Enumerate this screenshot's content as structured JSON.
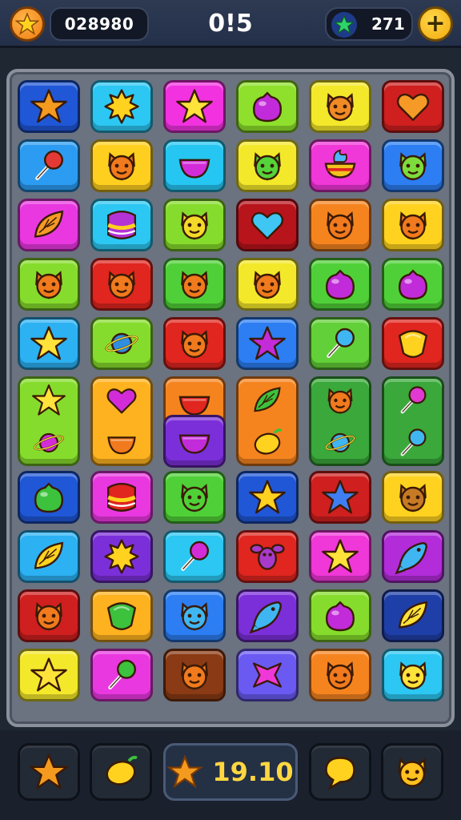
{
  "hud": {
    "coin_icon": "star-icon",
    "score": "028980",
    "timer": "0!5",
    "gems": "271",
    "gem_icon": "star-icon",
    "add_label": "+"
  },
  "board": {
    "tiles": [
      {
        "c": 0,
        "r": 0,
        "bg": "#1f57d6",
        "icon": "star",
        "fg": "#f39a1f"
      },
      {
        "c": 1,
        "r": 0,
        "bg": "#2cc7f2",
        "icon": "sun",
        "fg": "#ffd21f"
      },
      {
        "c": 2,
        "r": 0,
        "bg": "#f232e0",
        "icon": "star",
        "fg": "#ffe23a"
      },
      {
        "c": 3,
        "r": 0,
        "bg": "#8ee02c",
        "icon": "blob",
        "fg": "#c22bd9"
      },
      {
        "c": 4,
        "r": 0,
        "bg": "#f4e82a",
        "icon": "face",
        "fg": "#f08a25"
      },
      {
        "c": 5,
        "r": 0,
        "bg": "#cf1f1f",
        "icon": "heart",
        "fg": "#f59a26"
      },
      {
        "c": 0,
        "r": 1,
        "bg": "#2c9cf2",
        "icon": "pin",
        "fg": "#e53935"
      },
      {
        "c": 1,
        "r": 1,
        "bg": "#ffcf1f",
        "icon": "face",
        "fg": "#f07a1d"
      },
      {
        "c": 2,
        "r": 1,
        "bg": "#26c6f2",
        "icon": "bowl",
        "fg": "#d22cd9"
      },
      {
        "c": 3,
        "r": 1,
        "bg": "#f4e82a",
        "icon": "face",
        "fg": "#54d43a"
      },
      {
        "c": 4,
        "r": 1,
        "bg": "#f037d8",
        "icon": "cup",
        "fg": "#4db6ff"
      },
      {
        "c": 5,
        "r": 1,
        "bg": "#2c7ef2",
        "icon": "face",
        "fg": "#7ddc3c"
      },
      {
        "c": 0,
        "r": 2,
        "bg": "#e938e0",
        "icon": "leaf",
        "fg": "#f59a26"
      },
      {
        "c": 1,
        "r": 2,
        "bg": "#2cc7f2",
        "icon": "stack",
        "fg": "#b433d6"
      },
      {
        "c": 2,
        "r": 2,
        "bg": "#86dc2c",
        "icon": "face",
        "fg": "#f4d92a"
      },
      {
        "c": 3,
        "r": 2,
        "bg": "#b8141c",
        "icon": "heart",
        "fg": "#3fc6f2"
      },
      {
        "c": 4,
        "r": 2,
        "bg": "#f5841f",
        "icon": "face",
        "fg": "#f07a1d"
      },
      {
        "c": 5,
        "r": 2,
        "bg": "#ffd21f",
        "icon": "face",
        "fg": "#f07a1d"
      },
      {
        "c": 0,
        "r": 3,
        "bg": "#86dc2c",
        "icon": "face",
        "fg": "#f07a1d"
      },
      {
        "c": 1,
        "r": 3,
        "bg": "#e0261f",
        "icon": "face",
        "fg": "#f07a1d"
      },
      {
        "c": 2,
        "r": 3,
        "bg": "#50d038",
        "icon": "face",
        "fg": "#f07a1d"
      },
      {
        "c": 3,
        "r": 3,
        "bg": "#f4e82a",
        "icon": "face",
        "fg": "#f07a1d"
      },
      {
        "c": 4,
        "r": 3,
        "bg": "#50d038",
        "icon": "blob",
        "fg": "#c22bd9"
      },
      {
        "c": 5,
        "r": 3,
        "bg": "#50d038",
        "icon": "blob",
        "fg": "#c22bd9"
      },
      {
        "c": 0,
        "r": 4,
        "bg": "#2cb1f2",
        "icon": "star",
        "fg": "#ffe23a"
      },
      {
        "c": 1,
        "r": 4,
        "bg": "#86dc2c",
        "icon": "planet",
        "fg": "#2f8ee0"
      },
      {
        "c": 2,
        "r": 4,
        "bg": "#e0261f",
        "icon": "face",
        "fg": "#f07a1d"
      },
      {
        "c": 3,
        "r": 4,
        "bg": "#2c7ef2",
        "icon": "star",
        "fg": "#c42bd9"
      },
      {
        "c": 4,
        "r": 4,
        "bg": "#62d038",
        "icon": "pin",
        "fg": "#3fb6f2"
      },
      {
        "c": 5,
        "r": 4,
        "bg": "#e0261f",
        "icon": "shield",
        "fg": "#ffd21f"
      },
      {
        "c": 0,
        "r": 5,
        "bg": "#86dc2c",
        "icon": "star",
        "fg": "#ffe23a",
        "tall": true,
        "icon2": "planet",
        "fg2": "#d22cd9"
      },
      {
        "c": 1,
        "r": 5,
        "bg": "#ffb21f",
        "icon": "heart",
        "fg": "#d22cd9",
        "tall": true,
        "icon2": "bowl",
        "fg2": "#f07a1d"
      },
      {
        "c": 2,
        "r": 5,
        "bg": "#f5841f",
        "icon": "bowl",
        "fg": "#e0261f"
      },
      {
        "c": 3,
        "r": 5,
        "bg": "#f5841f",
        "icon": "leaf",
        "fg": "#3cc23c",
        "tall": true,
        "icon2": "lemon",
        "fg2": "#ffd21f"
      },
      {
        "c": 4,
        "r": 5,
        "bg": "#3aa83a",
        "icon": "face",
        "fg": "#f07a1d",
        "tall": true,
        "icon2": "planet",
        "fg2": "#3fb6f2"
      },
      {
        "c": 5,
        "r": 5,
        "bg": "#3aa83a",
        "icon": "pin",
        "fg": "#e03ad0",
        "tall": true,
        "icon2": "pin",
        "fg2": "#3fb6f2"
      },
      {
        "c": 2,
        "r": 6,
        "bg": "#7b2fd9",
        "icon": "bowl",
        "fg": "#c22bd9"
      },
      {
        "c": 0,
        "r": 7,
        "bg": "#1f57d6",
        "icon": "blob",
        "fg": "#3cc23c"
      },
      {
        "c": 1,
        "r": 7,
        "bg": "#e938e0",
        "icon": "stack",
        "fg": "#e0261f"
      },
      {
        "c": 2,
        "r": 7,
        "bg": "#50d038",
        "icon": "face",
        "fg": "#50d038"
      },
      {
        "c": 3,
        "r": 7,
        "bg": "#1f57d6",
        "icon": "star",
        "fg": "#ffd21f"
      },
      {
        "c": 4,
        "r": 7,
        "bg": "#cf1f1f",
        "icon": "star",
        "fg": "#3f7ef2"
      },
      {
        "c": 5,
        "r": 7,
        "bg": "#ffd21f",
        "icon": "face",
        "fg": "#c77a25"
      },
      {
        "c": 0,
        "r": 8,
        "bg": "#2cb1f2",
        "icon": "leaf",
        "fg": "#ffd21f"
      },
      {
        "c": 1,
        "r": 8,
        "bg": "#7b2fd9",
        "icon": "sun",
        "fg": "#ffd21f"
      },
      {
        "c": 2,
        "r": 8,
        "bg": "#2cc7f2",
        "icon": "pin",
        "fg": "#d22cd9"
      },
      {
        "c": 3,
        "r": 8,
        "bg": "#e0261f",
        "icon": "bug",
        "fg": "#a83acb"
      },
      {
        "c": 4,
        "r": 8,
        "bg": "#f037d8",
        "icon": "star",
        "fg": "#ffe23a"
      },
      {
        "c": 5,
        "r": 8,
        "bg": "#b22cd9",
        "icon": "fish",
        "fg": "#3fb6f2"
      },
      {
        "c": 0,
        "r": 9,
        "bg": "#cf1f1f",
        "icon": "face",
        "fg": "#f07a1d"
      },
      {
        "c": 1,
        "r": 9,
        "bg": "#ffb21f",
        "icon": "shield",
        "fg": "#3cc23c"
      },
      {
        "c": 2,
        "r": 9,
        "bg": "#2c7ef2",
        "icon": "face",
        "fg": "#3fb6f2"
      },
      {
        "c": 3,
        "r": 9,
        "bg": "#7b2fd9",
        "icon": "fish",
        "fg": "#3fb6f2"
      },
      {
        "c": 4,
        "r": 9,
        "bg": "#86dc2c",
        "icon": "blob",
        "fg": "#c22bd9"
      },
      {
        "c": 5,
        "r": 9,
        "bg": "#1f3fa8",
        "icon": "leaf",
        "fg": "#ffe23a"
      },
      {
        "c": 0,
        "r": 10,
        "bg": "#f4e82a",
        "icon": "star",
        "fg": "#ffe23a"
      },
      {
        "c": 1,
        "r": 10,
        "bg": "#e938e0",
        "icon": "pin",
        "fg": "#3cc23c"
      },
      {
        "c": 2,
        "r": 10,
        "bg": "#8a3a14",
        "icon": "face",
        "fg": "#f07a1d"
      },
      {
        "c": 3,
        "r": 10,
        "bg": "#6a5af2",
        "icon": "x",
        "fg": "#f037d8"
      },
      {
        "c": 4,
        "r": 10,
        "bg": "#f5841f",
        "icon": "face",
        "fg": "#f07a1d"
      },
      {
        "c": 5,
        "r": 10,
        "bg": "#2cc7f2",
        "icon": "face",
        "fg": "#ffe23a"
      }
    ]
  },
  "footer": {
    "moves": "19.10",
    "buttons": [
      {
        "name": "star-booster-button",
        "icon": "star",
        "fg": "#f39a1f"
      },
      {
        "name": "lemon-booster-button",
        "icon": "lemon",
        "fg": "#ffd21f"
      },
      {
        "name": "bubble-booster-button",
        "icon": "bubble",
        "fg": "#ffd21f"
      },
      {
        "name": "character-booster-button",
        "icon": "face",
        "fg": "#ffc21f"
      }
    ]
  }
}
